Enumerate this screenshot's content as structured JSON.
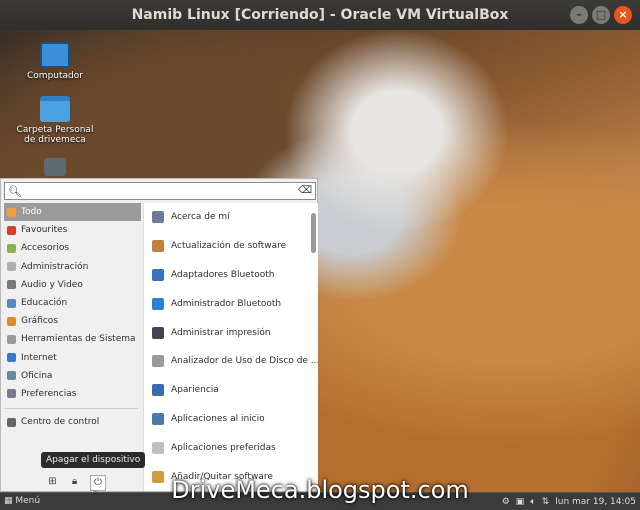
{
  "window": {
    "title": "Namib Linux [Corriendo] - Oracle VM VirtualBox"
  },
  "desktop": {
    "icons": [
      {
        "label": "Computador",
        "icon": "computer-icon"
      },
      {
        "label": "Carpeta Personal de drivemeca",
        "icon": "folder-icon"
      },
      {
        "label": "",
        "icon": "trash-icon"
      }
    ]
  },
  "menu": {
    "search": {
      "value": "",
      "placeholder": ""
    },
    "categories": [
      {
        "label": "Todo",
        "active": true,
        "color": "#f0a040"
      },
      {
        "label": "Favourites",
        "color": "#d04030"
      },
      {
        "label": "Accesorios",
        "color": "#8bb050"
      },
      {
        "label": "Administración",
        "color": "#b0b0b0"
      },
      {
        "label": "Audio y Video",
        "color": "#7a7a7a"
      },
      {
        "label": "Educación",
        "color": "#5a8ac0"
      },
      {
        "label": "Gráficos",
        "color": "#e08a30"
      },
      {
        "label": "Herramientas de Sistema",
        "color": "#9a9a9a"
      },
      {
        "label": "Internet",
        "color": "#3a78c8"
      },
      {
        "label": "Oficina",
        "color": "#6a8a9a"
      },
      {
        "label": "Preferencias",
        "color": "#7a7a8a"
      }
    ],
    "control_center": "Centro de control",
    "apps": [
      {
        "label": "Acerca de mí",
        "color": "#6a7a9a"
      },
      {
        "label": "Actualización de software",
        "color": "#c08040"
      },
      {
        "label": "Adaptadores Bluetooth",
        "color": "#3a70c0"
      },
      {
        "label": "Administrador Bluetooth",
        "color": "#2a80d0"
      },
      {
        "label": "Administrar impresión",
        "color": "#404650"
      },
      {
        "label": "Analizador de Uso de Disco de ...",
        "color": "#9a9a9a"
      },
      {
        "label": "Apariencia",
        "color": "#3a6ab0"
      },
      {
        "label": "Aplicaciones al inicio",
        "color": "#4a7ab0"
      },
      {
        "label": "Aplicaciones preferidas",
        "color": "#c0c0c0"
      },
      {
        "label": "Añadir/Quitar software",
        "color": "#d09a40"
      }
    ],
    "tooltip": "Apagar el dispositivo"
  },
  "taskbar": {
    "menu_label": "Menú",
    "clock": "lun mar 19, 14:05"
  },
  "watermark": "DriveMeca.blogspot.com"
}
